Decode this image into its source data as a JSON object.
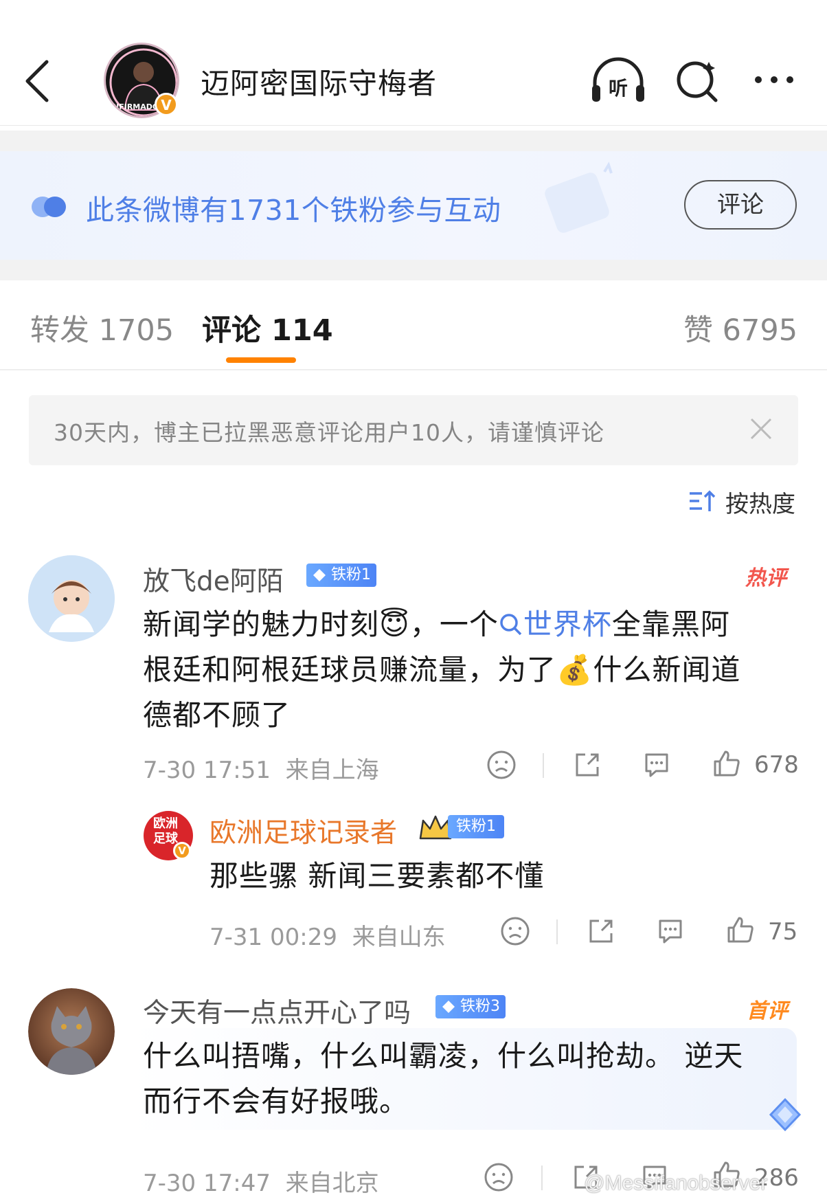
{
  "header": {
    "title": "迈阿密国际守梅者",
    "avatar_text": "NFIRMADO",
    "verified": "V"
  },
  "fan_banner": {
    "text": "此条微博有1731个铁粉参与互动",
    "button": "评论"
  },
  "tabs": {
    "repost": "转发 1705",
    "comments": "评论 114",
    "likes": "赞 6795"
  },
  "notice": {
    "text": "30天内，博主已拉黑恶意评论用户10人，请谨慎评论"
  },
  "sort": {
    "label": "按热度"
  },
  "comments": [
    {
      "username": "放飞de阿陌",
      "fan_badge": "铁粉1",
      "tag": "热评",
      "text_part1": "新闻学的魅力时刻",
      "emoji1": "😇",
      "text_part2": "，一个",
      "topic": "世界杯",
      "text_part3": "全靠黑阿",
      "text_line2_a": "根廷和阿根廷球员赚流量，为了",
      "emoji2": "💰",
      "text_line2_b": "什么新闻道",
      "text_line3": "德都不顾了",
      "time": "7-30 17:51",
      "location": "来自上海",
      "likes": "678",
      "reply": {
        "username": "欧洲足球记录者",
        "avatar_text_1": "欧洲",
        "avatar_text_2": "足球",
        "fan_badge": "铁粉1",
        "text": "那些骡 新闻三要素都不懂",
        "time": "7-31 00:29",
        "location": "来自山东",
        "likes": "75"
      }
    },
    {
      "username": "今天有一点点开心了吗",
      "fan_badge": "铁粉3",
      "tag": "首评",
      "text_line1": "什么叫捂嘴，什么叫霸凌，什么叫抢劫。 逆天",
      "text_line2": "而行不会有好报哦。",
      "time": "7-30 17:47",
      "location": "来自北京",
      "likes": "286"
    }
  ],
  "watermark": "@Messifanobserver",
  "colors": {
    "accent_orange": "#ff8200",
    "link_blue": "#4f7fe6",
    "hot_red": "#f2564d",
    "first_orange": "#ff8a1f",
    "reply_name": "#e8772a"
  }
}
